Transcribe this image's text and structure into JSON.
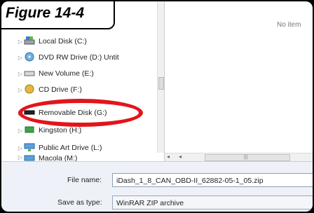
{
  "figure": {
    "label": "Figure 14-4"
  },
  "right_pane": {
    "empty_text": "No item"
  },
  "nav_tree": {
    "items": [
      {
        "label": "Local Disk (C:)",
        "icon": "local-disk-icon"
      },
      {
        "label": "DVD RW Drive (D:) Untit",
        "icon": "dvd-drive-icon"
      },
      {
        "label": "New Volume (E:)",
        "icon": "drive-icon"
      },
      {
        "label": "CD Drive (F:)",
        "icon": "cd-drive-icon"
      },
      {
        "label": "Removable Disk (G:)",
        "icon": "removable-disk-icon"
      },
      {
        "label": "Kingston (H:)",
        "icon": "usb-drive-icon"
      },
      {
        "label": "Public Art Drive (L:)",
        "icon": "network-drive-icon"
      },
      {
        "label": "Macola (M:)",
        "icon": "network-drive-icon"
      }
    ],
    "highlighted": "Removable Disk (G:)"
  },
  "form": {
    "file_name_label": "File name:",
    "file_name_value": "iDash_1_8_CAN_OBD-II_62882-05-1_05.zip",
    "save_as_type_label": "Save as type:",
    "save_as_type_value": "WinRAR ZIP archive"
  },
  "colors": {
    "highlight_ellipse": "#e2151b"
  }
}
